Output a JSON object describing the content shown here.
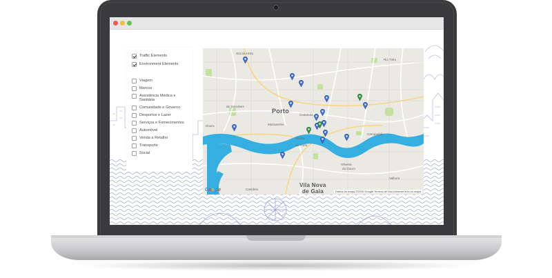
{
  "window": {
    "controls": [
      "close",
      "minimize",
      "zoom"
    ]
  },
  "sidebar": {
    "layers": [
      {
        "label": "Traffic Elements",
        "checked": true
      },
      {
        "label": "Environment Elements",
        "checked": true
      }
    ],
    "categories": [
      {
        "label": "Viagem",
        "checked": false
      },
      {
        "label": "Marcos",
        "checked": false
      },
      {
        "label": "Assistência Médica e Sanitária",
        "checked": false
      },
      {
        "label": "Comunidade e Governo",
        "checked": false
      },
      {
        "label": "Desportos e Lazer",
        "checked": false
      },
      {
        "label": "Serviços e Fornecimentos",
        "checked": false
      },
      {
        "label": "Automóvel",
        "checked": false
      },
      {
        "label": "Venda a Retalho",
        "checked": false
      },
      {
        "label": "Transporte",
        "checked": false
      },
      {
        "label": "Social",
        "checked": false
      }
    ]
  },
  "map": {
    "cities": {
      "porto": "Porto",
      "gaia_1": "Vila Nova",
      "gaia_2": "de Gaia"
    },
    "places": {
      "sra_hora": "Sra da Hora",
      "rio_tinto": "Rio Tinto",
      "massarelos": "Massarelos",
      "cedofeita": "Cedofeita",
      "campanha": "Campanhã",
      "oliveira": "Oliveira",
      "douro": "do Douro",
      "douro_left": "Douro",
      "canidelo": "Canidelo",
      "valbom": "Valbom",
      "serralves": "de Serralves",
      "vitoria": "Vitória",
      "do_porto": "do Porto"
    },
    "brand": {
      "g1": "G",
      "o1": "o",
      "o2": "o",
      "g2": "g",
      "l": "l",
      "e": "e"
    },
    "attribution": "Dados do mapa ©2016 Google    Termos de Uso    Informar erro no mapa",
    "colors": {
      "water": "#35aee0",
      "land": "#ebe9e4",
      "park": "#c4e19b",
      "pin_blue": "#3f6fd1",
      "pin_green": "#2f9a36"
    },
    "pins": [
      {
        "color": "blue"
      },
      {
        "color": "blue"
      },
      {
        "color": "blue"
      },
      {
        "color": "blue"
      },
      {
        "color": "blue"
      },
      {
        "color": "blue"
      },
      {
        "color": "blue"
      },
      {
        "color": "blue"
      },
      {
        "color": "blue"
      },
      {
        "color": "blue"
      },
      {
        "color": "blue"
      },
      {
        "color": "blue"
      },
      {
        "color": "blue"
      },
      {
        "color": "blue"
      },
      {
        "color": "blue"
      },
      {
        "color": "green"
      },
      {
        "color": "green"
      },
      {
        "color": "green"
      }
    ]
  }
}
